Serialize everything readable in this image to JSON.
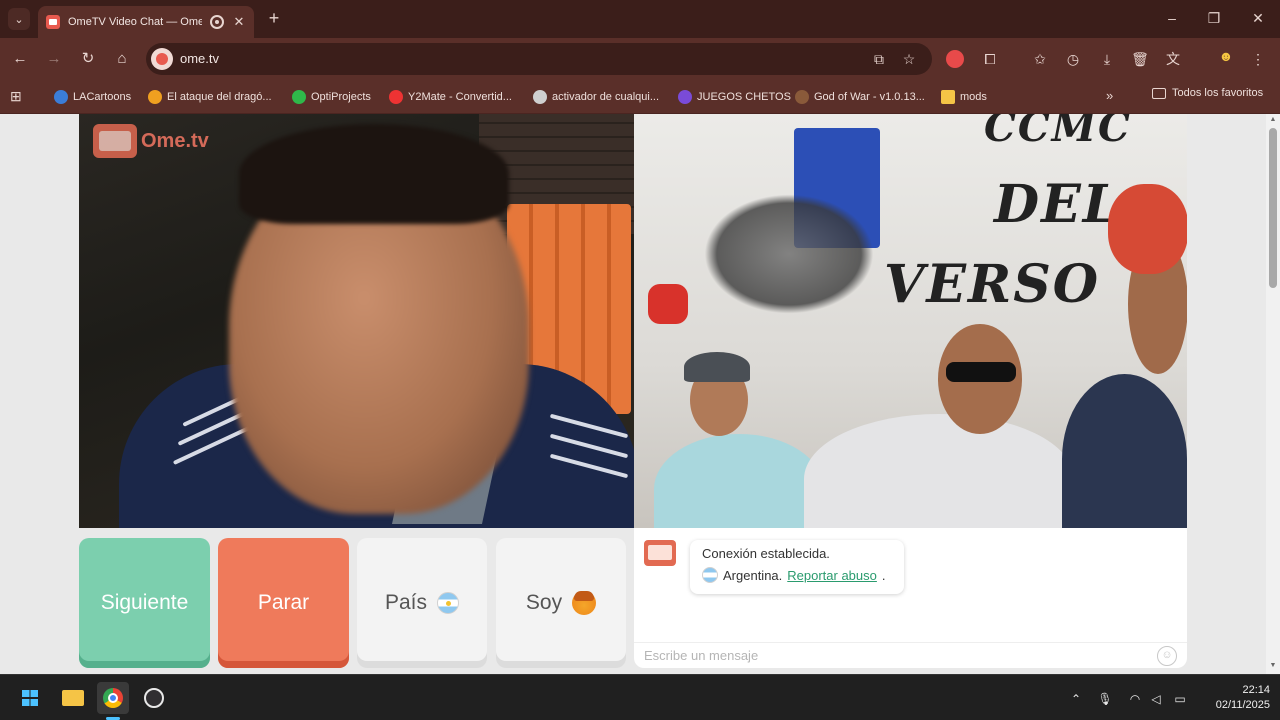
{
  "browser": {
    "tab_title": "OmeTV Video Chat — Ome",
    "url": "ome.tv",
    "new_tab_symbol": "+",
    "bookmarks": [
      {
        "label": "LACartoons",
        "color": "#3b7dd8"
      },
      {
        "label": "El ataque del dragó...",
        "color": "#f0a020"
      },
      {
        "label": "OptiProjects",
        "color": "#2fb84a"
      },
      {
        "label": "Y2Mate - Convertid...",
        "color": "#e33"
      },
      {
        "label": "activador de cualqui...",
        "color": "#cfcfcf"
      },
      {
        "label": "JUEGOS CHETOS",
        "color": "#7a4bd8"
      },
      {
        "label": "God of War - v1.0.13...",
        "color": "#8a5a3a"
      },
      {
        "label": "mods",
        "color": "#f5c446"
      }
    ],
    "bookmarks_more": "»",
    "all_bookmarks": "Todos los favoritos"
  },
  "video": {
    "logo_text": "Ome.tv"
  },
  "controls": {
    "next_label": "Siguiente",
    "stop_label": "Parar",
    "country_label": "País",
    "gender_label": "Soy"
  },
  "chat": {
    "status_line": "Conexión establecida.",
    "country": "Argentina.",
    "report_link": "Reportar abuso",
    "report_suffix": ".",
    "input_placeholder": "Escribe un mensaje",
    "emoji_icon": "☺"
  },
  "taskbar": {
    "time": "22:14",
    "date": "02/11/2025"
  },
  "colors": {
    "next_button": "#7ccfae",
    "stop_button": "#ef7a5b",
    "report_link": "#2a9b6e",
    "browser_frame": "#5a2f29"
  }
}
